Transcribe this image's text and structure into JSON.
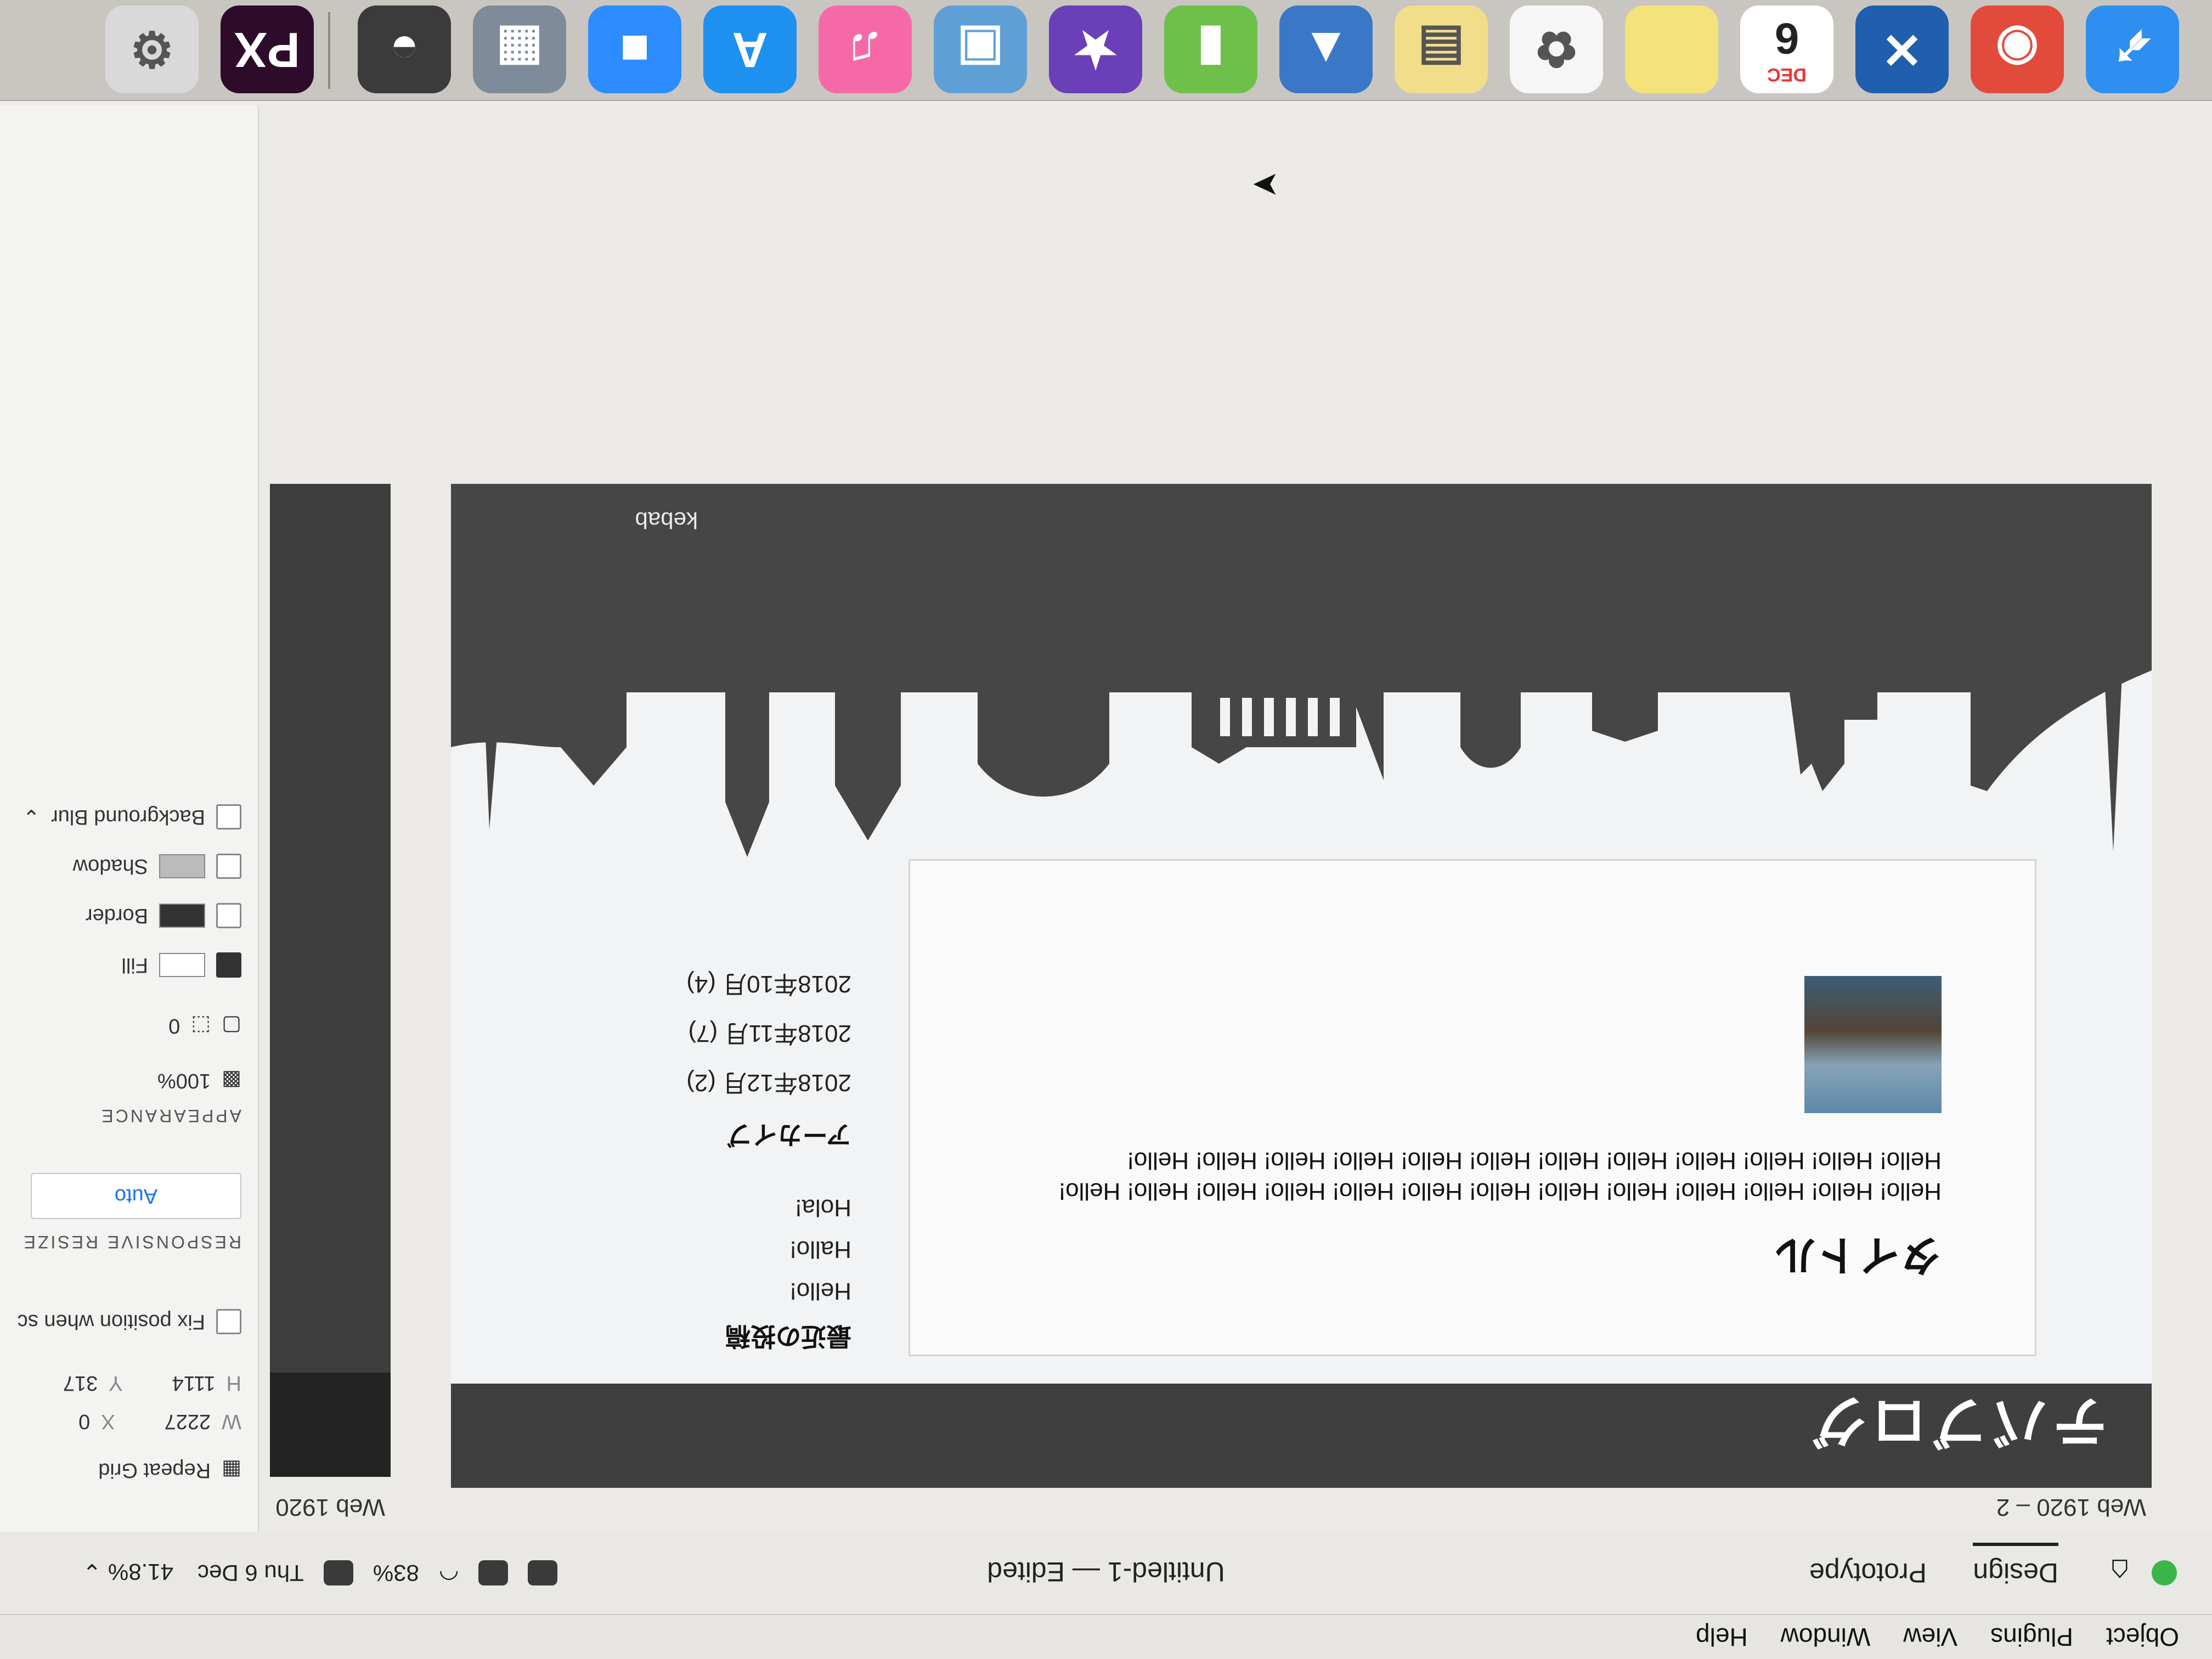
{
  "menubar": {
    "items": [
      "Object",
      "Plugins",
      "View",
      "Window",
      "Help"
    ]
  },
  "titlebar": {
    "tabs": [
      "Design",
      "Prototype"
    ],
    "document_title": "Untitled-1 — Edited",
    "zoom": "41.8%",
    "battery": "83%",
    "datetime": "Thu 6 Dec"
  },
  "canvas": {
    "artboard_label": "Web 1920 – 2",
    "artboard2_label": "Web 1920",
    "site_title": "テバブログ",
    "post": {
      "title": "タイトル",
      "body": "Hello! Hello! Hello! Hello! Hello! Hello! Hello! Hello! Hello! Hello! Hello! Hello! Hello! Hello! Hello! Hello! Hello! Hello! Hello! Hello! Hello! Hello! Hello! Hello! Hello!"
    },
    "sidebar": {
      "recent_heading": "最近の投稿",
      "recent_items": [
        "Hello!",
        "Hallo!",
        "Hola!"
      ],
      "archive_heading": "アーカイブ",
      "archive_items": [
        "2018年12月 (2)",
        "2018年11月 (7)",
        "2018年10月 (4)"
      ]
    },
    "footer_label": "kebab"
  },
  "inspector": {
    "repeat_grid": "Repeat Grid",
    "w_label": "W",
    "w_value": "2227",
    "x_label": "X",
    "x_value": "0",
    "h_label": "H",
    "h_value": "1114",
    "y_label": "Y",
    "y_value": "317",
    "fix_position": "Fix position when sc",
    "responsive_resize": "RESPONSIVE RESIZE",
    "auto": "Auto",
    "appearance": "APPEARANCE",
    "opacity": "100%",
    "radius": "0",
    "fill": "Fill",
    "border": "Border",
    "shadow": "Shadow",
    "background_blur": "Background Blur"
  },
  "dock": {
    "apps": [
      {
        "name": "Safari",
        "icon": "compass-icon",
        "color": "#2f8ff0"
      },
      {
        "name": "Chrome",
        "icon": "chrome-icon",
        "color": "#e24a3b"
      },
      {
        "name": "Xcode",
        "icon": "hammer-icon",
        "color": "#1f5fae"
      },
      {
        "name": "Calendar",
        "icon": "calendar-icon",
        "color": "#ffffff",
        "label": "DEC",
        "day": "6"
      },
      {
        "name": "Notes",
        "icon": "note-icon",
        "color": "#f4e27a"
      },
      {
        "name": "Photos",
        "icon": "flower-icon",
        "color": "#f6f6f6"
      },
      {
        "name": "Stickies",
        "icon": "stickies-icon",
        "color": "#f2de8a"
      },
      {
        "name": "Keynote",
        "icon": "presentation-icon",
        "color": "#3a78c7"
      },
      {
        "name": "Numbers",
        "icon": "bar-chart-icon",
        "color": "#6fbf4b"
      },
      {
        "name": "iMovie",
        "icon": "star-icon",
        "color": "#6a3fb8"
      },
      {
        "name": "Preview",
        "icon": "preview-icon",
        "color": "#5ea0d6"
      },
      {
        "name": "iTunes",
        "icon": "music-icon",
        "color": "#f56aa6"
      },
      {
        "name": "App Store",
        "icon": "appstore-icon",
        "color": "#1e90f0"
      },
      {
        "name": "Zoom",
        "icon": "video-camera-icon",
        "color": "#2d8cff"
      },
      {
        "name": "Image Capture",
        "icon": "image-capture-icon",
        "color": "#7d8b9a"
      },
      {
        "name": "Alfred",
        "icon": "hat-icon",
        "color": "#3b3b3b"
      },
      {
        "name": "Adobe XD",
        "icon": "xd-icon",
        "color": "#2e0b2a",
        "label": "PX"
      },
      {
        "name": "Preferences",
        "icon": "gear-icon",
        "color": "#d9d9d9"
      }
    ]
  }
}
